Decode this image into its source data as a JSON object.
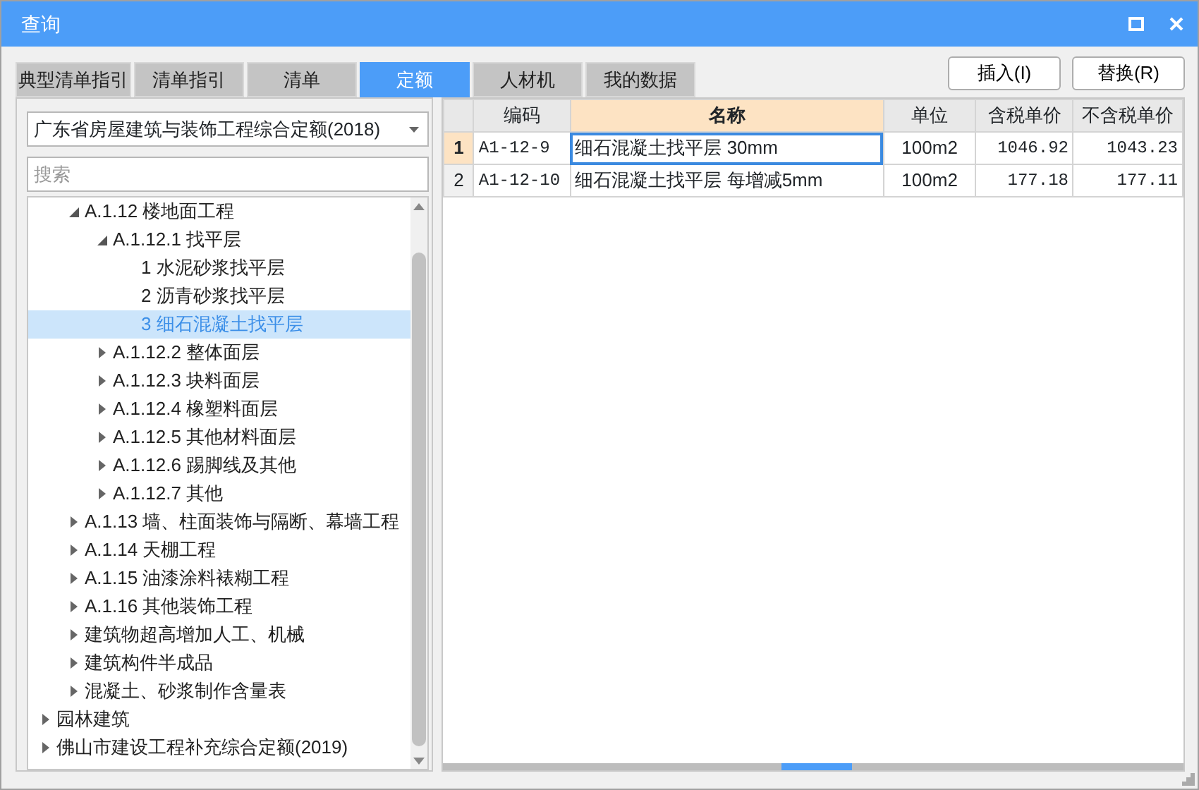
{
  "window": {
    "title": "查询"
  },
  "tabs": [
    {
      "label": "典型清单指引",
      "selected": false
    },
    {
      "label": "清单指引",
      "selected": false
    },
    {
      "label": "清单",
      "selected": false
    },
    {
      "label": "定额",
      "selected": true
    },
    {
      "label": "人材机",
      "selected": false
    },
    {
      "label": "我的数据",
      "selected": false
    }
  ],
  "buttons": [
    "插入(I)",
    "替换(R)"
  ],
  "library_select": {
    "value": "广东省房屋建筑与装饰工程综合定额(2018)"
  },
  "search": {
    "placeholder": "搜索"
  },
  "tree": {
    "items": [
      {
        "children": [
          {
            "label": "A.1.12 楼地面工程",
            "expanded": true,
            "selected": false,
            "children": [
              {
                "label": "A.1.12.1 找平层",
                "expanded": true,
                "selected": false,
                "children": [
                  {
                    "label": "1 水泥砂浆找平层",
                    "selected": false
                  },
                  {
                    "label": "2 沥青砂浆找平层",
                    "selected": false
                  },
                  {
                    "label": "3 细石混凝土找平层",
                    "selected": true
                  }
                ]
              },
              {
                "label": "A.1.12.2 整体面层",
                "expanded": false,
                "selected": false
              },
              {
                "label": "A.1.12.3 块料面层",
                "expanded": false,
                "selected": false
              },
              {
                "label": "A.1.12.4 橡塑料面层",
                "expanded": false,
                "selected": false
              },
              {
                "label": "A.1.12.5 其他材料面层",
                "expanded": false,
                "selected": false
              },
              {
                "label": "A.1.12.6 踢脚线及其他",
                "expanded": false,
                "selected": false
              },
              {
                "label": "A.1.12.7 其他",
                "expanded": false,
                "selected": false
              }
            ]
          },
          {
            "label": "A.1.13 墙、柱面装饰与隔断、幕墙工程",
            "expanded": false,
            "selected": false
          },
          {
            "label": "A.1.14 天棚工程",
            "expanded": false,
            "selected": false
          },
          {
            "label": "A.1.15 油漆涂料裱糊工程",
            "expanded": false,
            "selected": false
          },
          {
            "label": "A.1.16 其他装饰工程",
            "expanded": false,
            "selected": false
          },
          {
            "label": "建筑物超高增加人工、机械",
            "expanded": false,
            "selected": false
          },
          {
            "label": "建筑构件半成品",
            "expanded": false,
            "selected": false
          },
          {
            "label": "混凝土、砂浆制作含量表",
            "expanded": false,
            "selected": false
          }
        ]
      },
      {
        "label": "园林建筑",
        "expanded": false,
        "selected": false
      },
      {
        "label": "佛山市建设工程补充综合定额(2019)",
        "expanded": false,
        "selected": false
      }
    ]
  },
  "table": {
    "columns": [
      {
        "label": "编码",
        "selected": false
      },
      {
        "label": "名称",
        "selected": true
      },
      {
        "label": "单位",
        "selected": false
      },
      {
        "label": "含税单价",
        "selected": false
      },
      {
        "label": "不含税单价",
        "selected": false
      }
    ],
    "rows": [
      {
        "number": "1",
        "selected": true,
        "cells": [
          "A1-12-9",
          "细石混凝土找平层 30mm",
          "100m2",
          "1046.92",
          "1043.23"
        ]
      },
      {
        "number": "2",
        "selected": false,
        "cells": [
          "A1-12-10",
          "细石混凝土找平层 每增减5mm",
          "100m2",
          "177.18",
          "177.11"
        ]
      }
    ]
  }
}
